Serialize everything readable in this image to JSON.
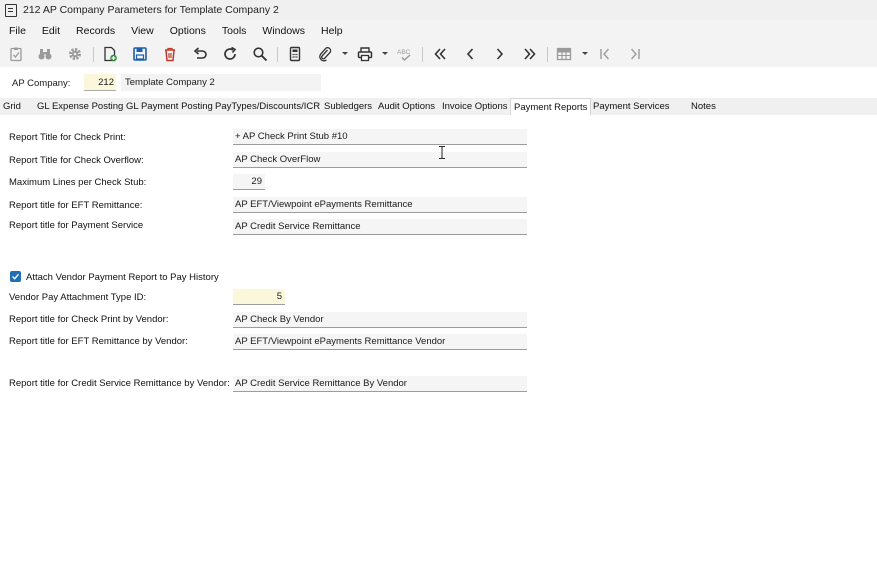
{
  "window": {
    "title": "212 AP Company Parameters for Template Company 2"
  },
  "menu": [
    "File",
    "Edit",
    "Records",
    "View",
    "Options",
    "Tools",
    "Windows",
    "Help"
  ],
  "toolbar": {
    "icons": [
      "clipboard-check-icon",
      "binoculars-icon",
      "gear-icon",
      "new-document-icon",
      "save-icon",
      "delete-icon",
      "undo-icon",
      "refresh-icon",
      "search-icon",
      "calculator-icon",
      "attachment-icon",
      "print-icon",
      "spellcheck-icon",
      "first-record-icon",
      "previous-record-icon",
      "next-record-icon",
      "last-record-icon",
      "grid-icon",
      "first-page-icon",
      "last-page-icon"
    ],
    "spellcheck_label": "ABC"
  },
  "company": {
    "label": "AP Company:",
    "number": "212",
    "name": "Template Company 2"
  },
  "tabs": [
    "Grid",
    "GL Expense Posting",
    "GL Payment Posting",
    "PayTypes/Discounts/ICR",
    "Subledgers",
    "Audit Options",
    "Invoice Options",
    "Payment Reports",
    "Payment Services",
    "Notes"
  ],
  "active_tab": "Payment Reports",
  "fields": {
    "check_print_title": {
      "label": "Report Title for Check Print:",
      "value": "+ AP Check Print Stub #10"
    },
    "check_overflow": {
      "label": "Report Title for Check Overflow:",
      "value": "AP Check OverFlow"
    },
    "max_lines": {
      "label": "Maximum Lines per Check Stub:",
      "value": "29"
    },
    "eft_remittance": {
      "label": "Report title for EFT Remittance:",
      "value": "AP EFT/Viewpoint ePayments Remittance"
    },
    "payment_service": {
      "label": "Report title for Payment Service",
      "value": "AP Credit Service Remittance"
    },
    "attach_vendor": {
      "label": "Attach Vendor Payment Report to Pay History",
      "checked": true
    },
    "vendor_attach_type": {
      "label": "Vendor Pay Attachment Type ID:",
      "value": "5"
    },
    "check_by_vendor": {
      "label": "Report title for Check Print by Vendor:",
      "value": "AP Check By Vendor"
    },
    "eft_by_vendor": {
      "label": "Report title for EFT Remittance by Vendor:",
      "value": "AP EFT/Viewpoint ePayments Remittance Vendor"
    },
    "credit_by_vendor": {
      "label": "Report title for Credit Service Remittance by Vendor:",
      "value": "AP Credit Service Remittance By Vendor"
    }
  },
  "colors": {
    "accent": "#1f6fb5",
    "required_field": "#fbf7da",
    "save_blue": "#1d5fa8",
    "delete_red": "#c0392b"
  }
}
